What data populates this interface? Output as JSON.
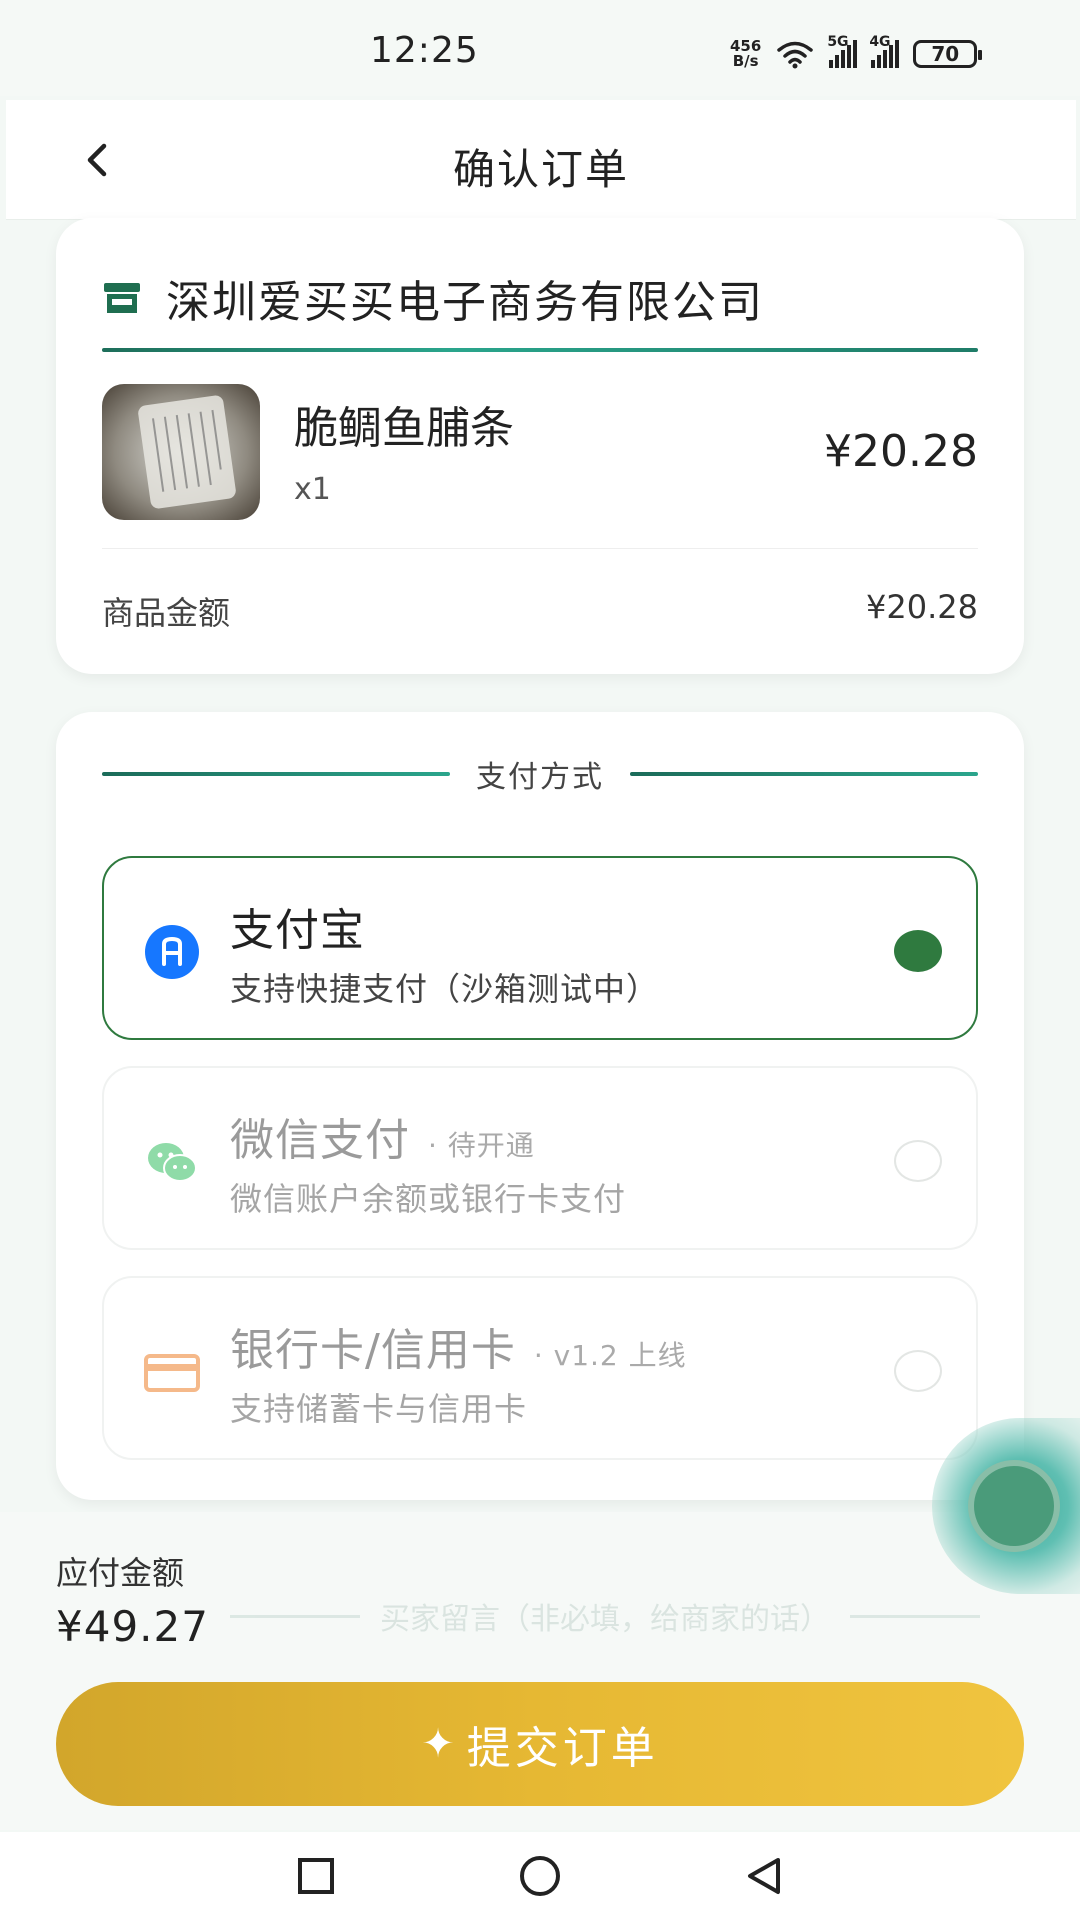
{
  "status_bar": {
    "time": "12:25",
    "net_speed_value": "456",
    "net_speed_unit": "B/s",
    "signal_1": "5G",
    "signal_2": "4G",
    "battery": "70"
  },
  "header": {
    "title": "确认订单",
    "back_icon": "chevron-left-icon"
  },
  "order": {
    "shop_icon": "store-icon",
    "shop_name": "深圳爱买买电子商务有限公司",
    "product": {
      "name": "脆鲷鱼脯条",
      "quantity": "x1",
      "price": "¥20.28"
    },
    "subtotal_label": "商品金额",
    "subtotal_value": "¥20.28"
  },
  "payment": {
    "heading": "支付方式",
    "options": [
      {
        "title": "支付宝",
        "subtitle": "支持快捷支付（沙箱测试中）",
        "tag": "",
        "icon": "alipay-icon",
        "selected": true,
        "enabled": true
      },
      {
        "title": "微信支付",
        "subtitle": "微信账户余额或银行卡支付",
        "tag": "· 待开通",
        "icon": "wechat-icon",
        "selected": false,
        "enabled": false
      },
      {
        "title": "银行卡/信用卡",
        "subtitle": "支持储蓄卡与信用卡",
        "tag": "· v1.2 上线",
        "icon": "bank-card-icon",
        "selected": false,
        "enabled": false
      }
    ]
  },
  "summary": {
    "remark_hint": "买家留言（非必填，给商家的话）",
    "total_label": "应付金额",
    "total_value": "¥49.27"
  },
  "submit": {
    "icon": "sparkle-icon",
    "label": "提交订单"
  },
  "colors": {
    "accent_green": "#2f7a3f",
    "teal": "#2aa58c",
    "gold": "#e6b833"
  }
}
